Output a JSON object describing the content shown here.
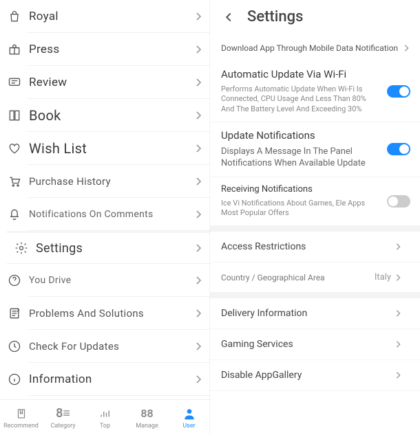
{
  "menu": [
    {
      "label": "Royal",
      "icon": "bag"
    },
    {
      "label": "Press",
      "icon": "gift"
    },
    {
      "label": "Review",
      "icon": "comment"
    },
    {
      "label": "Book",
      "icon": "book"
    },
    {
      "label": "Wish List",
      "icon": "heart"
    },
    {
      "label": "Purchase History",
      "icon": "cart"
    },
    {
      "label": "Notifications On Comments",
      "icon": "bell"
    },
    {
      "label": "Settings",
      "icon": "gear"
    },
    {
      "label": "You Drive",
      "icon": "help"
    },
    {
      "label": "Problems And Solutions",
      "icon": "note"
    },
    {
      "label": "Check For Updates",
      "icon": "update"
    },
    {
      "label": "Information",
      "icon": "info"
    }
  ],
  "tabs": [
    {
      "label": "Recommend",
      "icon": "bookmark"
    },
    {
      "label": "Category",
      "icon": "category"
    },
    {
      "label": "Top",
      "icon": "stats"
    },
    {
      "label": "Manage",
      "icon": "manage"
    },
    {
      "label": "User",
      "icon": "user",
      "active": true
    }
  ],
  "settings": {
    "title": "Settings",
    "download_row": "Download App Through Mobile Data Notification",
    "auto_update": {
      "title": "Automatic Update Via Wi-Fi",
      "desc": "Performs Automatic Update When Wi-Fi Is Connected, CPU Usage And Less Than 80% And The Battery Level And Exceeding 30%",
      "on": true
    },
    "update_notif": {
      "title": "Update Notifications",
      "desc": "Displays A Message In The Panel Notifications When Available Update",
      "on": true
    },
    "recv_notif": {
      "title": "Receiving Notifications",
      "desc": "Ice Vi Notifications About Games, Ele Apps Most Popular Offers",
      "on": false
    },
    "access": "Access Restrictions",
    "country_label": "Country / Geographical Area",
    "country_value": "Italy",
    "delivery": "Delivery Information",
    "gaming": "Gaming Services",
    "disable": "Disable AppGallery"
  }
}
